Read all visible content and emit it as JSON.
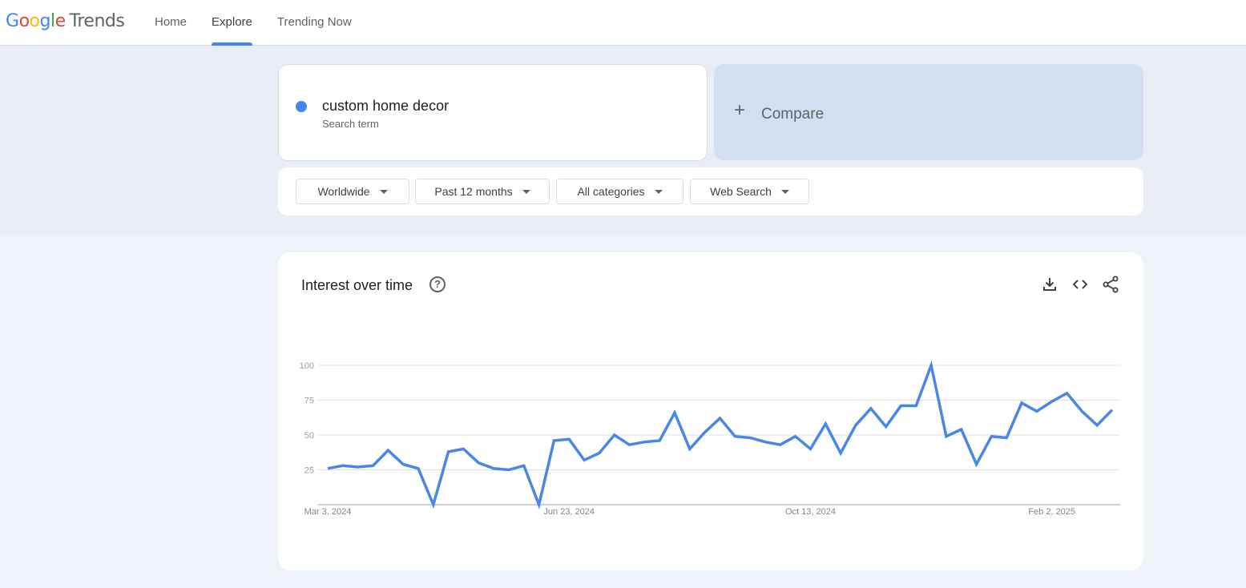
{
  "header": {
    "logo_google": [
      "G",
      "o",
      "o",
      "g",
      "l",
      "e"
    ],
    "logo_trends": "Trends",
    "nav": [
      {
        "label": "Home",
        "active": false
      },
      {
        "label": "Explore",
        "active": true
      },
      {
        "label": "Trending Now",
        "active": false
      }
    ]
  },
  "search": {
    "term": "custom home decor",
    "term_type": "Search term",
    "term_color": "#4285f4",
    "compare_icon": "+",
    "compare_label": "Compare"
  },
  "filters": [
    {
      "label": "Worldwide"
    },
    {
      "label": "Past 12 months"
    },
    {
      "label": "All categories"
    },
    {
      "label": "Web Search"
    }
  ],
  "interest": {
    "title": "Interest over time",
    "icons": [
      "help-icon",
      "download-icon",
      "embed-code-icon",
      "share-icon"
    ]
  },
  "chart_data": {
    "type": "line",
    "title": "Interest over time",
    "xlabel": "",
    "ylabel": "",
    "ylim": [
      0,
      100
    ],
    "y_ticks": [
      25,
      50,
      75,
      100
    ],
    "x_tick_labels": [
      "Mar 3, 2024",
      "Jun 23, 2024",
      "Oct 13, 2024",
      "Feb 2, 2025"
    ],
    "grid": true,
    "series": [
      {
        "color": "#4a86e8",
        "values": [
          26,
          28,
          27,
          28,
          39,
          29,
          26,
          0,
          38,
          40,
          30,
          26,
          25,
          28,
          0,
          46,
          47,
          32,
          37,
          50,
          43,
          45,
          46,
          66,
          40,
          52,
          62,
          49,
          48,
          45,
          43,
          49,
          40,
          58,
          37,
          57,
          69,
          56,
          71,
          71,
          100,
          49,
          54,
          29,
          49,
          48,
          73,
          67,
          74,
          80,
          67,
          57,
          68
        ]
      }
    ]
  }
}
